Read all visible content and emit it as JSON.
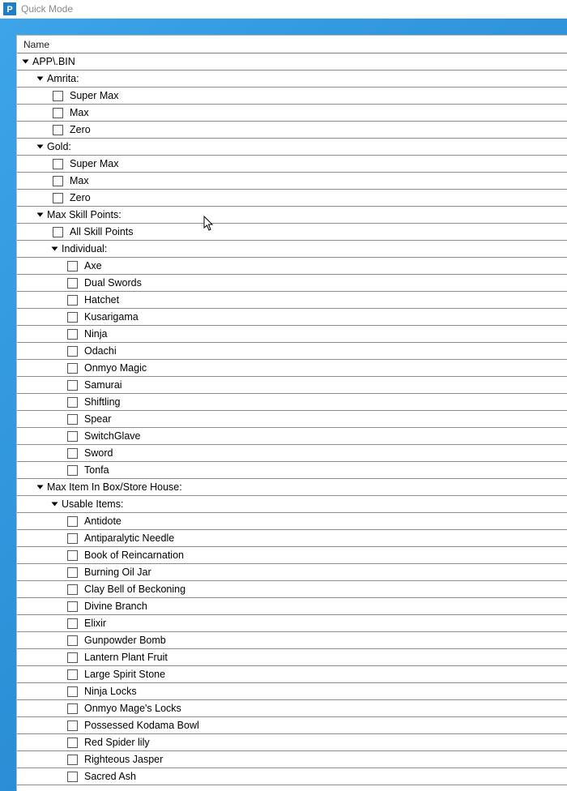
{
  "window": {
    "title": "Quick Mode"
  },
  "header": {
    "name": "Name"
  },
  "tree": {
    "root": "APP\\.BIN",
    "amrita": {
      "label": "Amrita:",
      "items": [
        "Super Max",
        "Max",
        "Zero"
      ]
    },
    "gold": {
      "label": "Gold:",
      "items": [
        "Super Max",
        "Max",
        "Zero"
      ]
    },
    "maxSkill": {
      "label": "Max Skill Points:",
      "all": "All Skill Points",
      "individual": {
        "label": "Individual:",
        "items": [
          "Axe",
          "Dual Swords",
          "Hatchet",
          "Kusarigama",
          "Ninja",
          "Odachi",
          "Onmyo Magic",
          "Samurai",
          "Shiftling",
          "Spear",
          "SwitchGlave",
          "Sword",
          "Tonfa"
        ]
      }
    },
    "maxItem": {
      "label": "Max Item In Box/Store House:",
      "usable": {
        "label": "Usable Items:",
        "items": [
          "Antidote",
          "Antiparalytic Needle",
          "Book of Reincarnation",
          "Burning Oil Jar",
          "Clay Bell of Beckoning",
          "Divine Branch",
          "Elixir",
          "Gunpowder Bomb",
          "Lantern Plant Fruit",
          "Large Spirit Stone",
          "Ninja Locks",
          "Onmyo Mage's Locks",
          "Possessed Kodama Bowl",
          "Red Spider lily",
          "Righteous Jasper",
          "Sacred Ash"
        ]
      }
    }
  }
}
